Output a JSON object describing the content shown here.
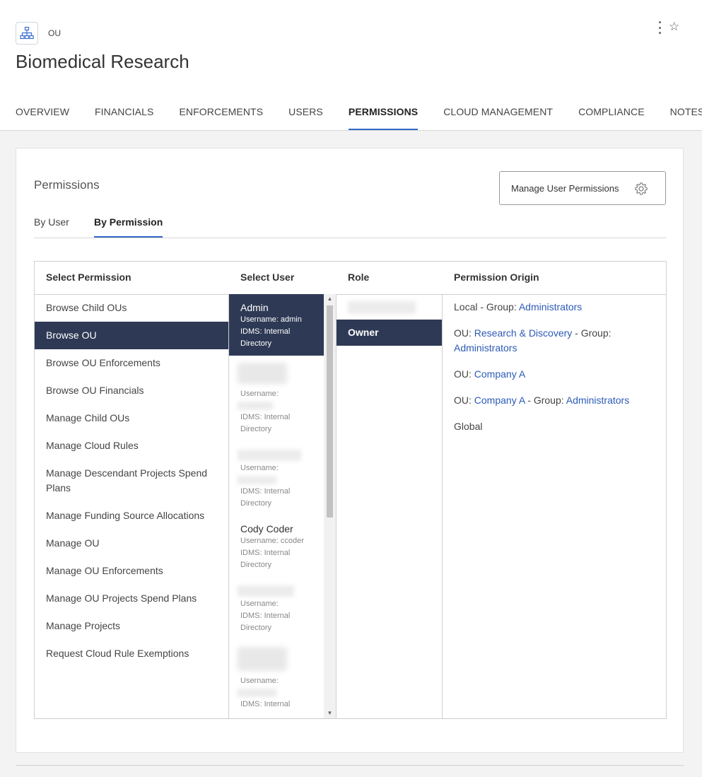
{
  "header": {
    "type_label": "OU",
    "title": "Biomedical Research",
    "icon": "org-chart-icon"
  },
  "tabs": [
    {
      "label": "OVERVIEW",
      "active": false
    },
    {
      "label": "FINANCIALS",
      "active": false
    },
    {
      "label": "ENFORCEMENTS",
      "active": false
    },
    {
      "label": "USERS",
      "active": false
    },
    {
      "label": "PERMISSIONS",
      "active": true
    },
    {
      "label": "CLOUD MANAGEMENT",
      "active": false
    },
    {
      "label": "COMPLIANCE",
      "active": false
    },
    {
      "label": "NOTES",
      "active": false
    }
  ],
  "card": {
    "title": "Permissions",
    "manage_button": "Manage User Permissions",
    "subtabs": [
      {
        "label": "By User",
        "active": false
      },
      {
        "label": "By Permission",
        "active": true
      }
    ]
  },
  "grid": {
    "headers": {
      "permission": "Select Permission",
      "user": "Select User",
      "role": "Role",
      "origin": "Permission Origin"
    },
    "permissions": [
      "Browse Child OUs",
      "Browse OU",
      "Browse OU Enforcements",
      "Browse OU Financials",
      "Manage Child OUs",
      "Manage Cloud Rules",
      "Manage Descendant Projects Spend Plans",
      "Manage Funding Source Allocations",
      "Manage OU",
      "Manage OU Enforcements",
      "Manage OU Projects Spend Plans",
      "Manage Projects",
      "Request Cloud Rule Exemptions"
    ],
    "selected_permission": "Browse OU",
    "users": {
      "admin": {
        "name": "Admin",
        "username": "Username: admin",
        "idms": "IDMS: Internal Directory"
      },
      "blurred_1": {
        "username": "Username:",
        "idms": "IDMS: Internal Directory"
      },
      "blurred_2": {
        "username": "Username:",
        "idms": "IDMS: Internal Directory"
      },
      "cody": {
        "name": "Cody Coder",
        "username": "Username: ccoder",
        "idms": "IDMS: Internal Directory"
      },
      "blurred_3": {
        "username": "Username:",
        "idms": "IDMS: Internal Directory"
      },
      "blurred_4": {
        "username": "Username:",
        "idms": "IDMS: Internal"
      }
    },
    "role": "Owner",
    "origins": {
      "o1": {
        "prefix": "Local - Group: ",
        "group": "Administrators"
      },
      "o2": {
        "prefix": "OU: ",
        "ou": "Research & Discovery",
        "mid": " - Group: ",
        "group": "Administrators"
      },
      "o3": {
        "prefix": "OU: ",
        "ou": "Company A"
      },
      "o4": {
        "prefix": "OU: ",
        "ou": "Company A",
        "mid": " - Group: ",
        "group": "Administrators"
      },
      "o5": {
        "text": "Global"
      }
    }
  },
  "colors": {
    "selected_bg": "#2e3a55",
    "link": "#2d5ab7",
    "tab_underline": "#3469c7"
  }
}
